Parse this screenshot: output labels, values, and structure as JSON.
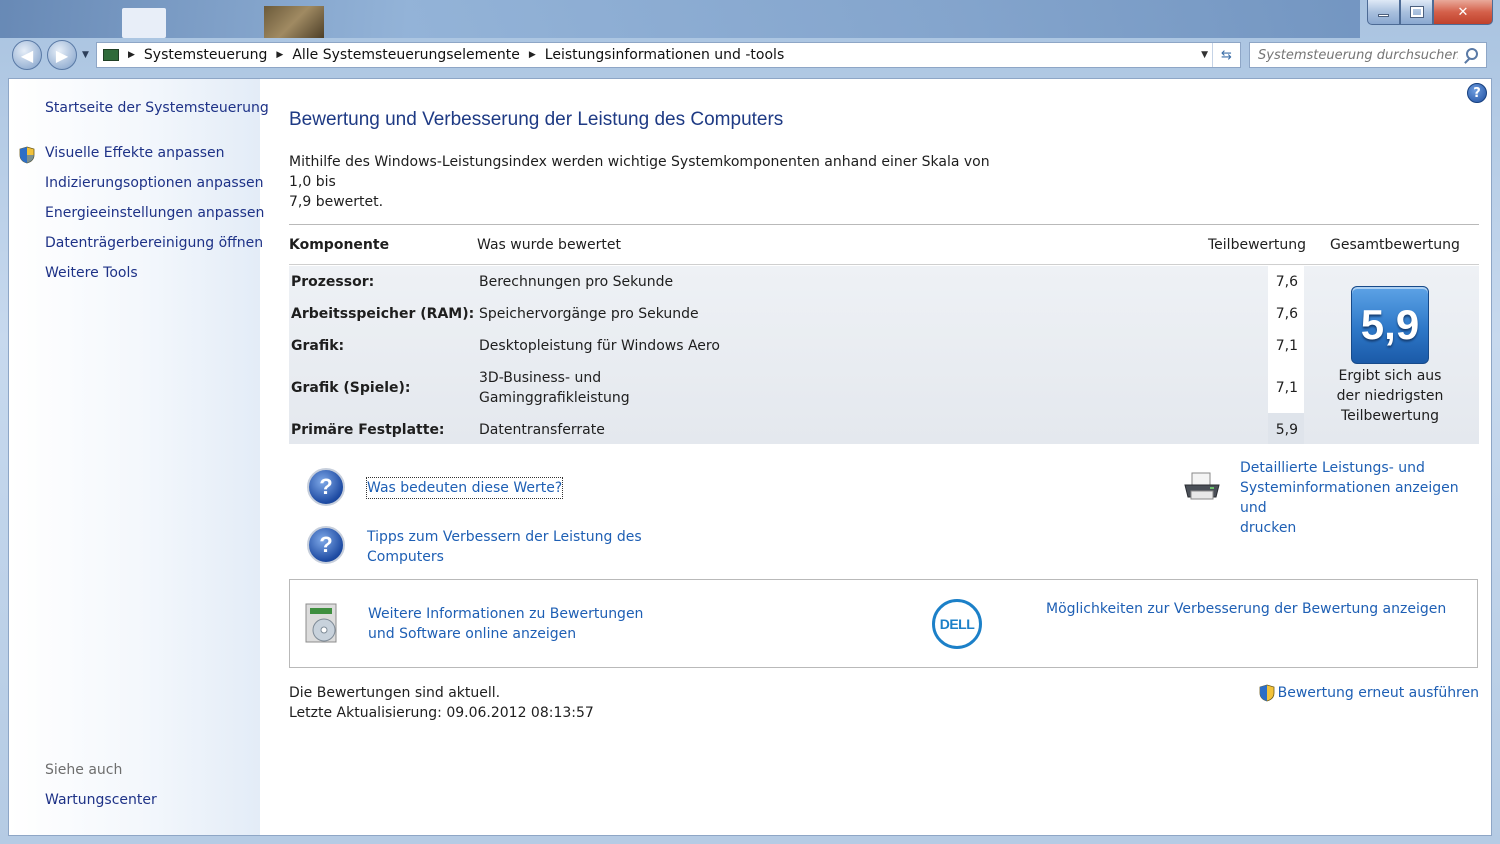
{
  "window": {
    "minimize": "",
    "maximize": "",
    "close": "✕"
  },
  "address_bar": {
    "breadcrumbs": [
      "Systemsteuerung",
      "Alle Systemsteuerungselemente",
      "Leistungsinformationen und -tools"
    ]
  },
  "search": {
    "placeholder": "Systemsteuerung durchsuchen"
  },
  "sidebar": {
    "home_link": "Startseite der Systemsteuerung",
    "items": [
      "Visuelle Effekte anpassen",
      "Indizierungsoptionen anpassen",
      "Energieeinstellungen anpassen",
      "Datenträgerbereinigung öffnen",
      "Weitere Tools"
    ],
    "see_also_heading": "Siehe auch",
    "see_also_items": [
      "Wartungscenter"
    ]
  },
  "main": {
    "title": "Bewertung und Verbesserung der Leistung des Computers",
    "intro_line1": "Mithilfe des Windows-Leistungsindex werden wichtige Systemkomponenten anhand einer Skala von 1,0 bis",
    "intro_line2": "7,9 bewertet.",
    "table": {
      "headers": {
        "component": "Komponente",
        "what": "Was wurde bewertet",
        "subscore": "Teilbewertung",
        "basescore": "Gesamtbewertung"
      },
      "rows": [
        {
          "component": "Prozessor:",
          "what": "Berechnungen pro Sekunde",
          "what2": "",
          "score": "7,6"
        },
        {
          "component": "Arbeitsspeicher (RAM):",
          "what": "Speichervorgänge pro Sekunde",
          "what2": "",
          "score": "7,6"
        },
        {
          "component": "Grafik:",
          "what": "Desktopleistung für Windows Aero",
          "what2": "",
          "score": "7,1"
        },
        {
          "component": "Grafik (Spiele):",
          "what": "3D-Business- und",
          "what2": "Gaminggrafikleistung",
          "score": "7,1"
        },
        {
          "component": "Primäre Festplatte:",
          "what": "Datentransferrate",
          "what2": "",
          "score": "5,9"
        }
      ],
      "base_score": "5,9",
      "base_note": "Ergibt sich aus der niedrigsten Teilbewertung"
    },
    "links": {
      "what_mean": "Was bedeuten diese Werte?",
      "tips_line1": "Tipps zum Verbessern der Leistung des",
      "tips_line2": "Computers",
      "details_line1": "Detaillierte Leistungs- und",
      "details_line2": "Systeminformationen anzeigen und",
      "details_line3": "drucken",
      "more_info_line1": "Weitere Informationen zu Bewertungen",
      "more_info_line2": "und Software online anzeigen",
      "dell_improve": "Möglichkeiten zur Verbesserung der Bewertung anzeigen",
      "rerun": "Bewertung erneut ausführen"
    },
    "dell_logo_text": "DELL",
    "status_line1": "Die Bewertungen sind aktuell.",
    "status_line2": "Letzte Aktualisierung: 09.06.2012 08:13:57"
  },
  "icons": {
    "help": "?",
    "question": "?",
    "back": "back-arrow-icon",
    "forward": "forward-arrow-icon"
  },
  "colors": {
    "link": "#1e5fb4",
    "sidebar_link": "#1e3287",
    "title": "#1e3a84",
    "base_tile": "#2e78c8"
  }
}
